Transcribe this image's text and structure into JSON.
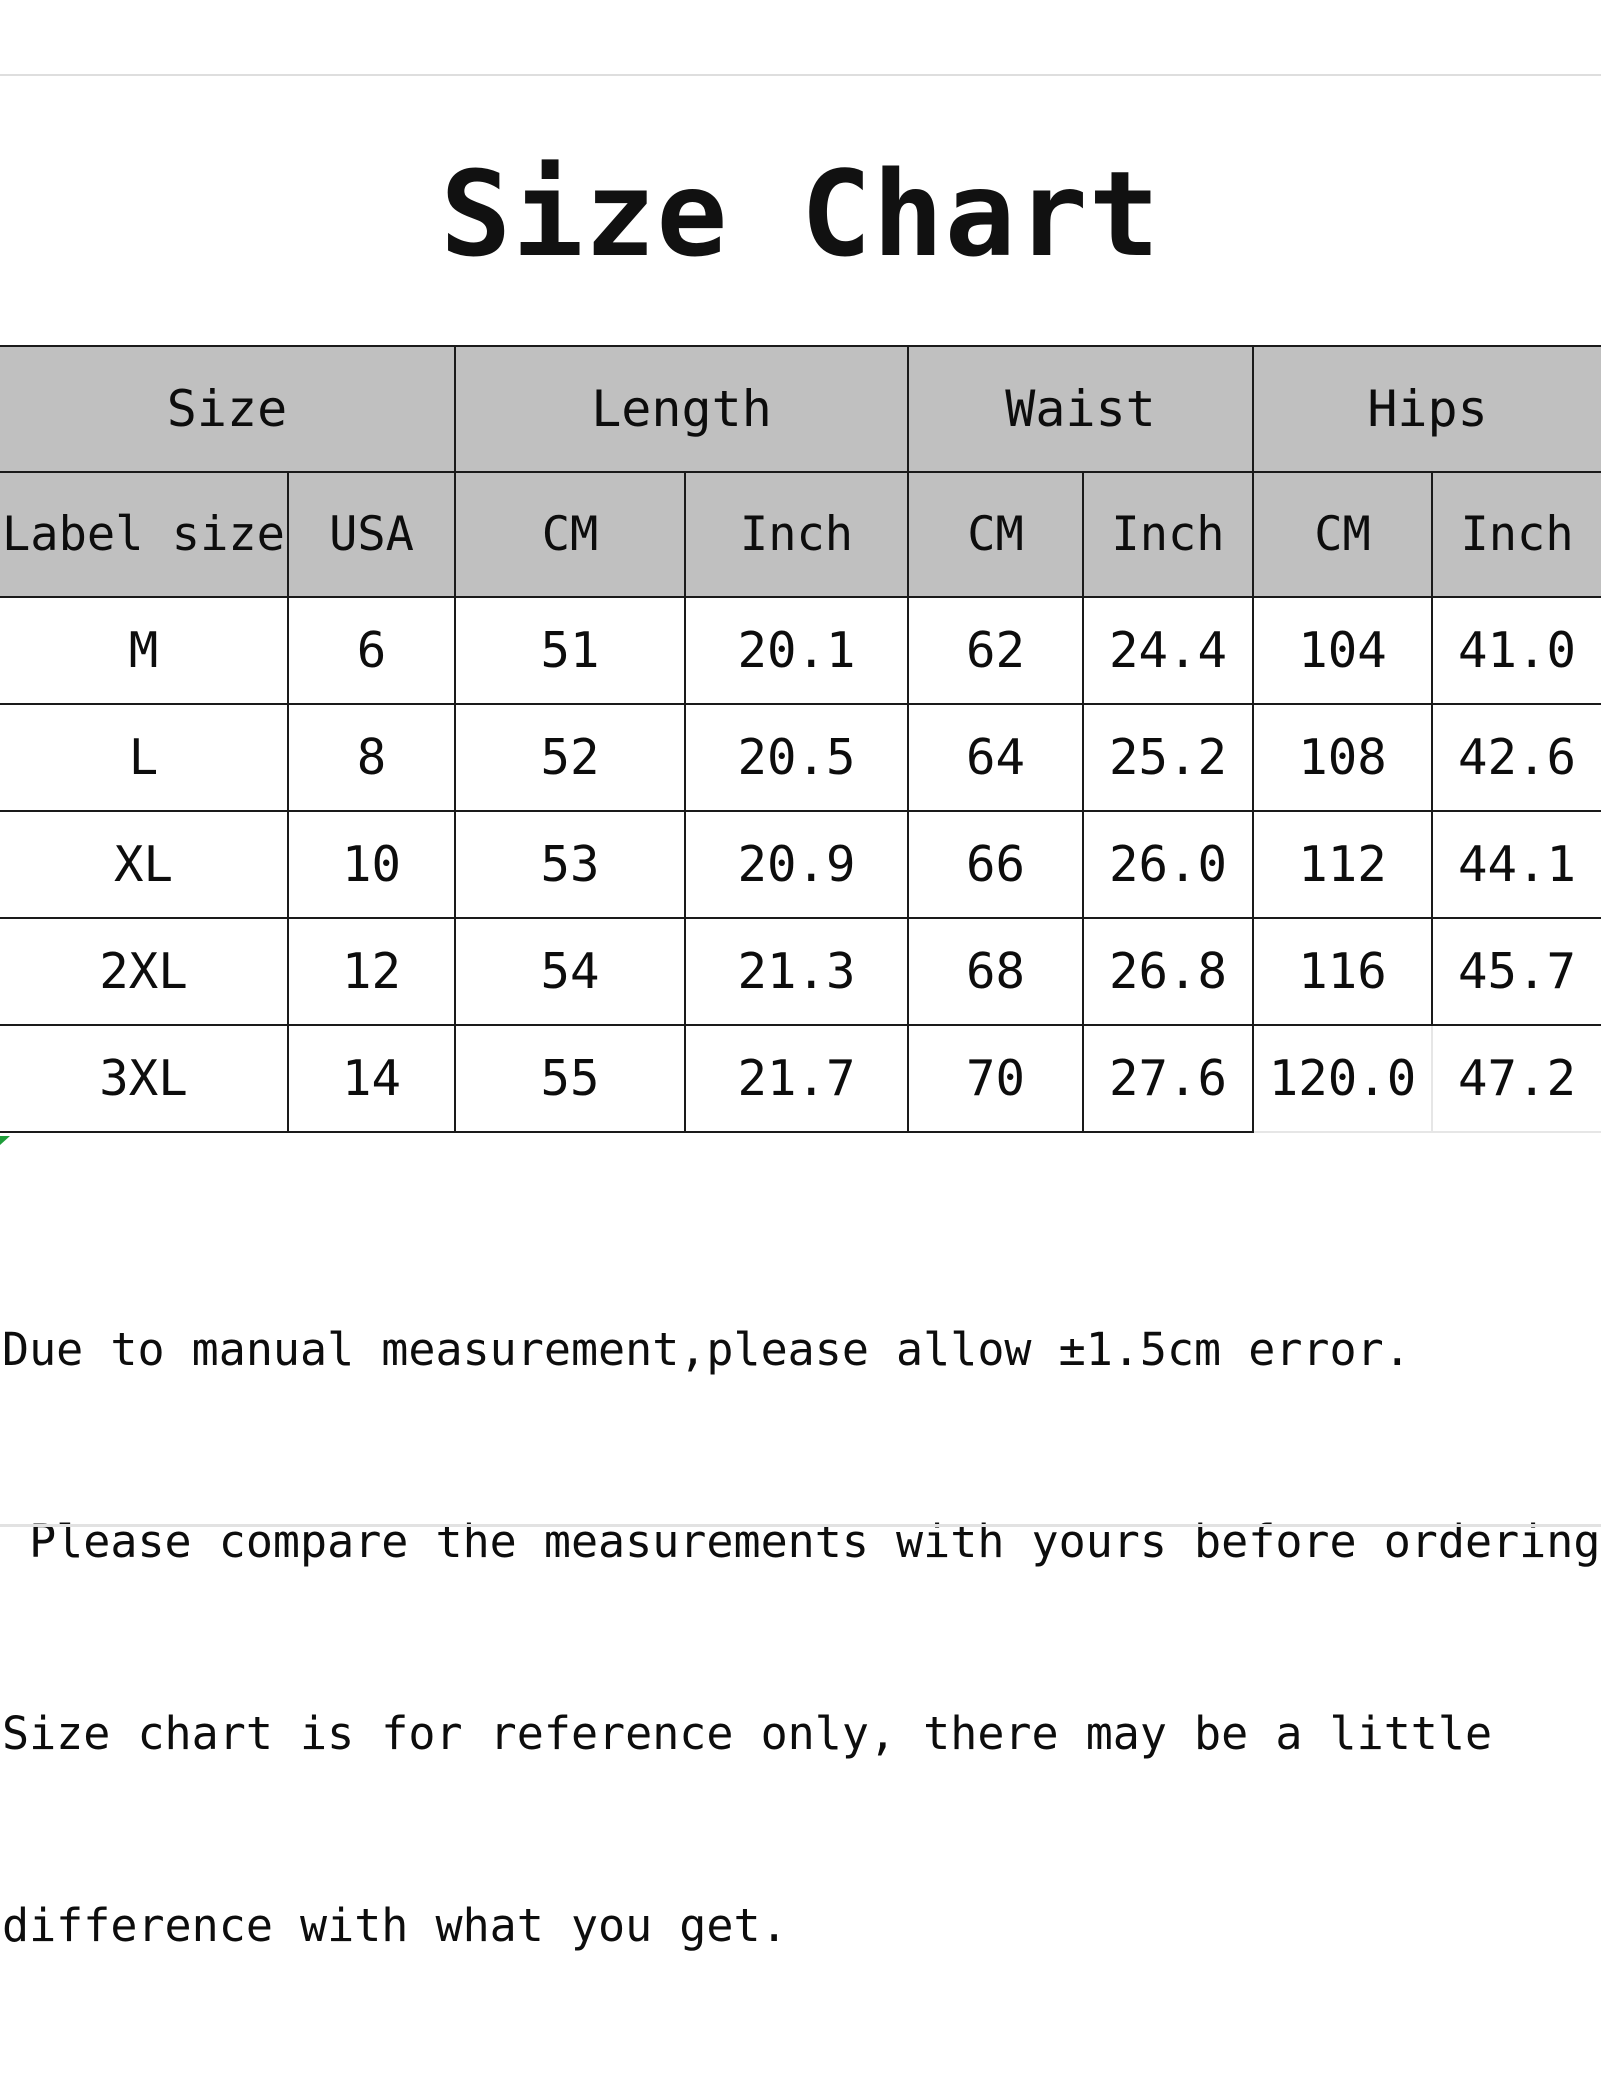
{
  "page": {
    "title": "Size Chart",
    "header_bg": "#c0c0c0",
    "border_color": "#1a1a1a",
    "text_color": "#0d0d0d"
  },
  "table": {
    "group_headers": [
      {
        "label": "Size",
        "span": 2
      },
      {
        "label": "Length",
        "span": 2
      },
      {
        "label": "Waist",
        "span": 2
      },
      {
        "label": "Hips",
        "span": 2
      }
    ],
    "sub_headers": [
      "Label size",
      "USA",
      "CM",
      "Inch",
      "CM",
      "Inch",
      "CM",
      "Inch"
    ],
    "rows": [
      {
        "label_size": "M",
        "usa": "6",
        "length_cm": "51",
        "length_inch": "20.1",
        "waist_cm": "62",
        "waist_inch": "24.4",
        "hips_cm": "104",
        "hips_inch": "41.0"
      },
      {
        "label_size": "L",
        "usa": "8",
        "length_cm": "52",
        "length_inch": "20.5",
        "waist_cm": "64",
        "waist_inch": "25.2",
        "hips_cm": "108",
        "hips_inch": "42.6"
      },
      {
        "label_size": "XL",
        "usa": "10",
        "length_cm": "53",
        "length_inch": "20.9",
        "waist_cm": "66",
        "waist_inch": "26.0",
        "hips_cm": "112",
        "hips_inch": "44.1"
      },
      {
        "label_size": "2XL",
        "usa": "12",
        "length_cm": "54",
        "length_inch": "21.3",
        "waist_cm": "68",
        "waist_inch": "26.8",
        "hips_cm": "116",
        "hips_inch": "45.7"
      },
      {
        "label_size": "3XL",
        "usa": "14",
        "length_cm": "55",
        "length_inch": "21.7",
        "waist_cm": "70",
        "waist_inch": "27.6",
        "hips_cm": "120.0",
        "hips_inch": "47.2"
      }
    ]
  },
  "notes": {
    "line1": "Due to manual measurement,please allow ±1.5cm error.",
    "line2": " Please compare the measurements with yours before ordering.",
    "line3": "Size chart is for reference only, there may be a little",
    "line4": "difference with what you get."
  }
}
